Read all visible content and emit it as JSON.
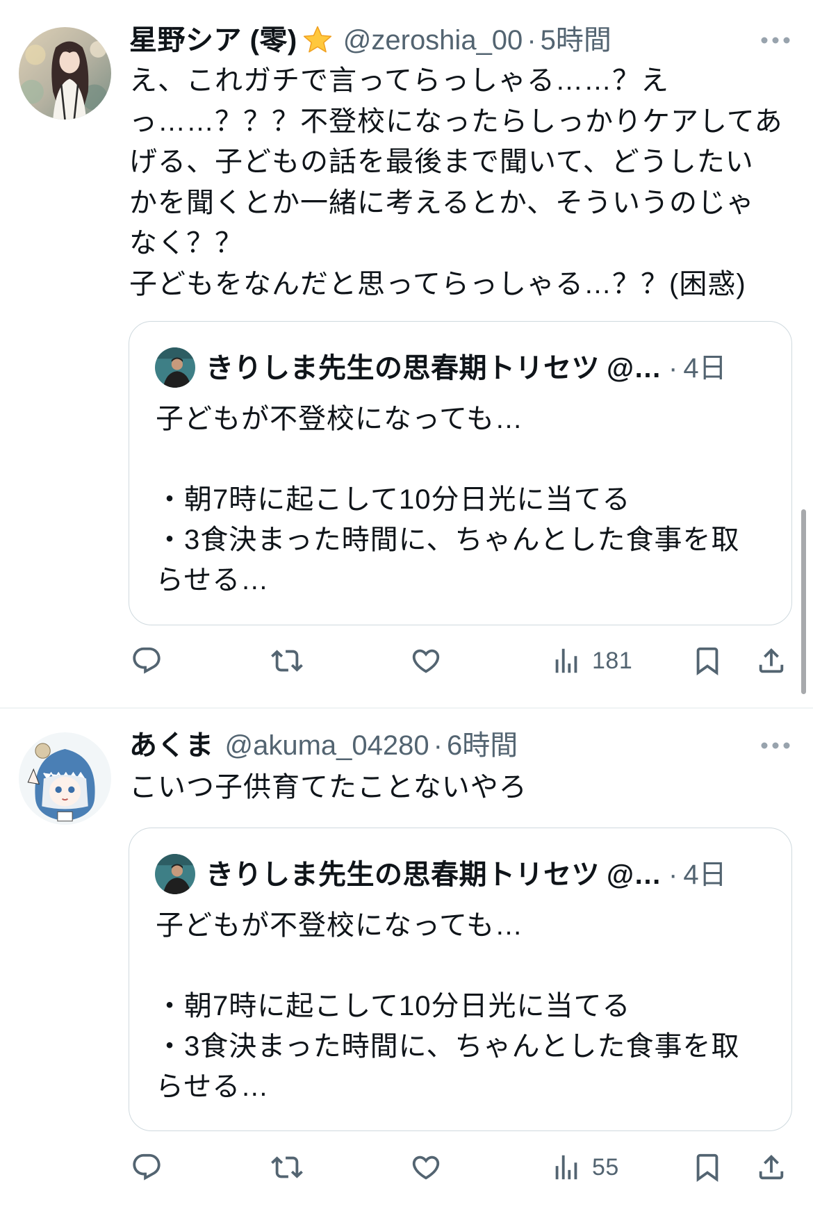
{
  "timeline": {
    "tweets": [
      {
        "author": {
          "name": "星野シア (零)",
          "badge_icon": "star-emoji-icon",
          "handle": "@zeroshia_00",
          "separator": "·",
          "time": "5時間"
        },
        "text_lines": [
          "え、これガチで言ってらっしゃる……？え",
          "っ……？？？不登校になったらしっかりケアしてあ",
          "げる、子どもの話を最後まで聞いて、どうしたい",
          "かを聞くとか一緒に考えるとか、そういうのじゃ",
          "なく？？",
          "子どもをなんだと思ってらっしゃる…？？(困惑)"
        ],
        "quote": {
          "author": {
            "name": "きりしま先生の思春期トリセツ",
            "handle": "@…",
            "separator": "·",
            "time": "4日"
          },
          "text_lines": [
            "子どもが不登校になっても…",
            "",
            "・朝7時に起こして10分日光に当てる",
            "・3食決まった時間に、ちゃんとした食事を取",
            "らせる…"
          ]
        },
        "metrics": {
          "views": "181"
        }
      },
      {
        "author": {
          "name": "あくま",
          "handle": "@akuma_04280",
          "separator": "·",
          "time": "6時間"
        },
        "text_lines": [
          "こいつ子供育てたことないやろ"
        ],
        "quote": {
          "author": {
            "name": "きりしま先生の思春期トリセツ",
            "handle": "@…",
            "separator": "·",
            "time": "4日"
          },
          "text_lines": [
            "子どもが不登校になっても…",
            "",
            "・朝7時に起こして10分日光に当てる",
            "・3食決まった時間に、ちゃんとした食事を取",
            "らせる…"
          ]
        },
        "metrics": {
          "views": "55"
        }
      }
    ]
  },
  "icons": {
    "reply": "reply-icon",
    "retweet": "retweet-icon",
    "like": "heart-icon",
    "views": "bar-chart-icon",
    "bookmark": "bookmark-icon",
    "share": "share-icon",
    "more": "more-horizontal-icon"
  },
  "colors": {
    "text": "#0f1419",
    "secondary": "#536471",
    "border": "#cfd9de",
    "divider": "#eff3f4",
    "background": "#ffffff",
    "star": "#ffc83d"
  }
}
